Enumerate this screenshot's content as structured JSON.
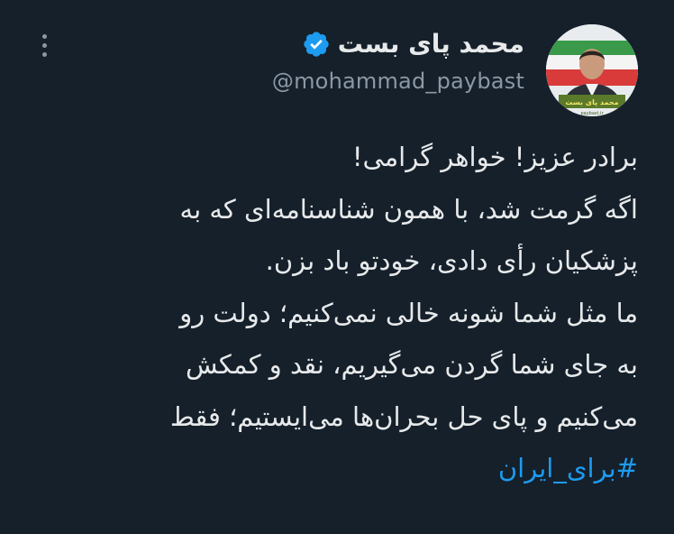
{
  "author": {
    "display_name": "محمد پای بست",
    "handle": "@mohammad_paybast",
    "verified": true,
    "verified_icon": "verified-badge-icon",
    "avatar_banner_text": "محمد پای بست",
    "avatar_banner_subtext": "paybast.ir"
  },
  "menu": {
    "icon": "more-vertical-icon"
  },
  "tweet": {
    "lines": [
      "برادر عزیز! خواهر گرامی!",
      "اگه گرمت شد، با همون شناسنامه‌ای که به",
      "پزشکیان رأی دادی، خودتو باد بزن.",
      "ما مثل شما شونه خالی نمی‌کنیم؛ دولت رو",
      "به جای شما گردن می‌گیریم، نقد و کمکش",
      "می‌کنیم و پای حل بحران‌ها می‌ایستیم؛ فقط"
    ],
    "hashtag": "#برای_ایران"
  },
  "colors": {
    "background": "#15202b",
    "text": "#e7e9ea",
    "secondary_text": "#8b98a5",
    "link": "#1d9bf0",
    "verified": "#1d9bf0"
  }
}
